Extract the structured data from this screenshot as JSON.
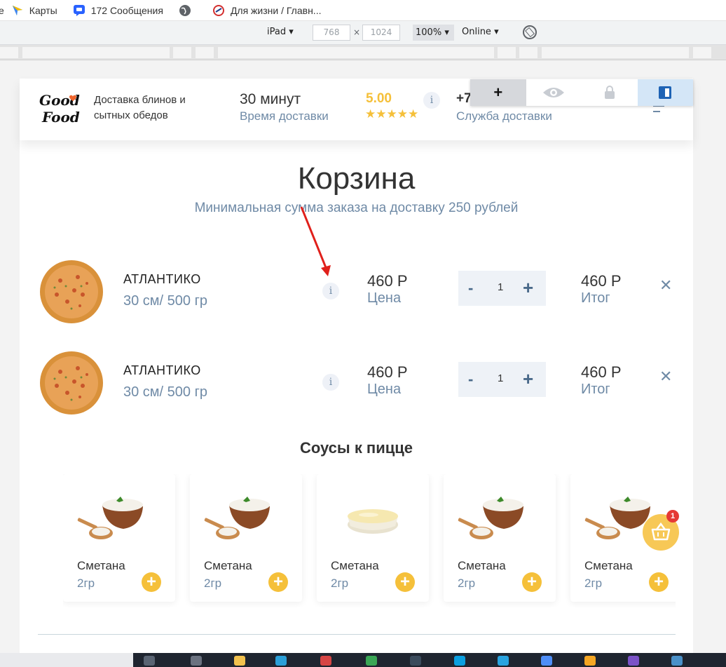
{
  "bookmarks": [
    {
      "label": "е",
      "icon": "none"
    },
    {
      "label": "Карты",
      "icon": "maps-icon"
    },
    {
      "label": "172 Сообщения",
      "icon": "messages-icon"
    },
    {
      "label": "",
      "icon": "globe-icon"
    },
    {
      "label": "Для жизни / Главн...",
      "icon": "site-icon"
    }
  ],
  "device_toolbar": {
    "device": "iPad",
    "width": "768",
    "height": "1024",
    "x": "×",
    "zoom": "100%",
    "network": "Online"
  },
  "header": {
    "tagline": "Доставка блинов и сытных обедов",
    "delivery_time": "30 минут",
    "delivery_label": "Время доставки",
    "rating": "5.00",
    "stars": "★★★★★",
    "info": "i",
    "phone": "+7 (",
    "service_label": "Служба доставки"
  },
  "extension": {
    "plus": "+"
  },
  "cart": {
    "title": "Корзина",
    "subtitle": "Минимальная сумма заказа на доставку 250 рублей",
    "items": [
      {
        "name": "АТЛАНТИКО",
        "size": "30 см/ 500 гр",
        "info": "i",
        "price": "460 Р",
        "price_label": "Цена",
        "minus": "-",
        "qty": "1",
        "plus": "+",
        "total": "460 Р",
        "total_label": "Итог",
        "remove": "✕"
      },
      {
        "name": "АТЛАНТИКО",
        "size": "30 см/ 500 гр",
        "info": "i",
        "price": "460 Р",
        "price_label": "Цена",
        "minus": "-",
        "qty": "1",
        "plus": "+",
        "total": "460 Р",
        "total_label": "Итог",
        "remove": "✕"
      }
    ]
  },
  "sauces": {
    "title": "Соусы к пицце",
    "items": [
      {
        "name": "Сметана",
        "weight": "2гр",
        "add": "+",
        "image": "sour-cream-bowl"
      },
      {
        "name": "Сметана",
        "weight": "2гр",
        "add": "+",
        "image": "sour-cream-bowl"
      },
      {
        "name": "Сметана",
        "weight": "2гр",
        "add": "+",
        "image": "sauce-dish"
      },
      {
        "name": "Сметана",
        "weight": "2гр",
        "add": "+",
        "image": "sour-cream-bowl"
      },
      {
        "name": "Сметана",
        "weight": "2гр",
        "add": "+",
        "image": "sour-cream-bowl"
      }
    ]
  },
  "basket": {
    "count": "1"
  },
  "colors": {
    "accent_blue": "#6f8aa6",
    "accent_yellow": "#f5c03a",
    "badge_red": "#e53935"
  }
}
